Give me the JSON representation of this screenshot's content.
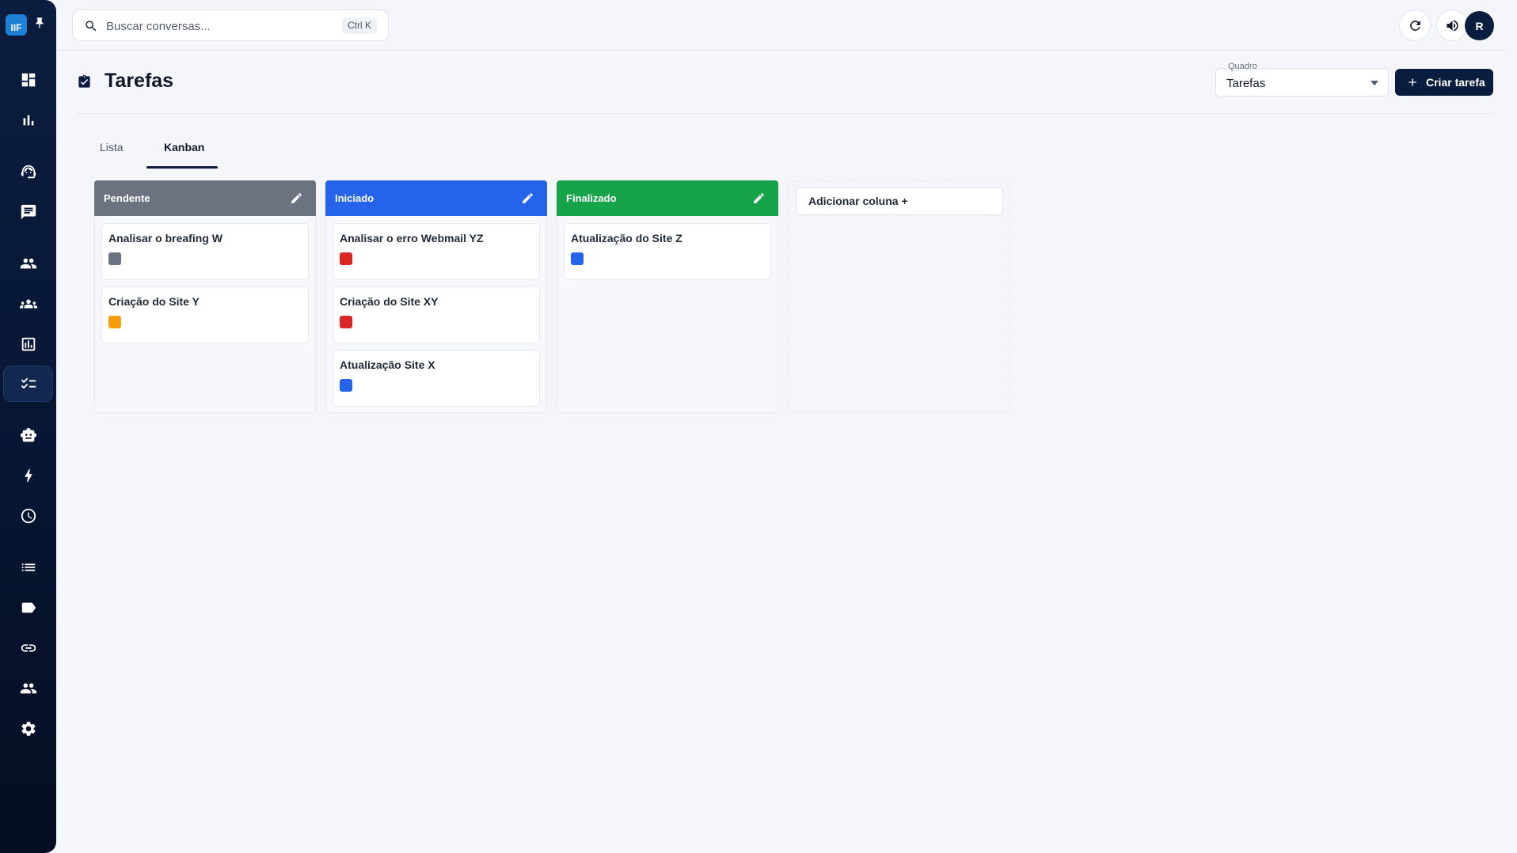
{
  "app": {
    "logo_text": "IIF"
  },
  "topbar": {
    "search_placeholder": "Buscar conversas...",
    "search_shortcut": "Ctrl K",
    "avatar_initial": "R"
  },
  "page": {
    "title": "Tarefas",
    "board_label": "Quadro",
    "board_value": "Tarefas",
    "create_label": "Criar tarefa"
  },
  "tabs": [
    {
      "label": "Lista",
      "active": false
    },
    {
      "label": "Kanban",
      "active": true
    }
  ],
  "columns": [
    {
      "title": "Pendente",
      "color": "#6b7280",
      "cards": [
        {
          "title": "Analisar o breafing W",
          "color": "#6b7280"
        },
        {
          "title": "Criação do Site Y",
          "color": "#f59e0b"
        }
      ]
    },
    {
      "title": "Iniciado",
      "color": "#2563eb",
      "cards": [
        {
          "title": "Analisar o erro Webmail YZ",
          "color": "#dc2626"
        },
        {
          "title": "Criação do Site XY",
          "color": "#dc2626"
        },
        {
          "title": "Atualização Site X",
          "color": "#2563eb"
        }
      ]
    },
    {
      "title": "Finalizado",
      "color": "#16a34a",
      "cards": [
        {
          "title": "Atualização do Site Z",
          "color": "#2563eb"
        }
      ]
    }
  ],
  "add_column_label": "Adicionar coluna +",
  "sidebar_icons": [
    "dashboard-icon",
    "bar-chart-icon",
    "support-agent-icon",
    "chat-icon",
    "contacts-icon",
    "groups-icon",
    "reports-icon",
    "tasks-icon",
    "bot-icon",
    "flash-icon",
    "clock-icon",
    "list-icon",
    "tag-icon",
    "link-icon",
    "users-icon",
    "settings-icon"
  ]
}
